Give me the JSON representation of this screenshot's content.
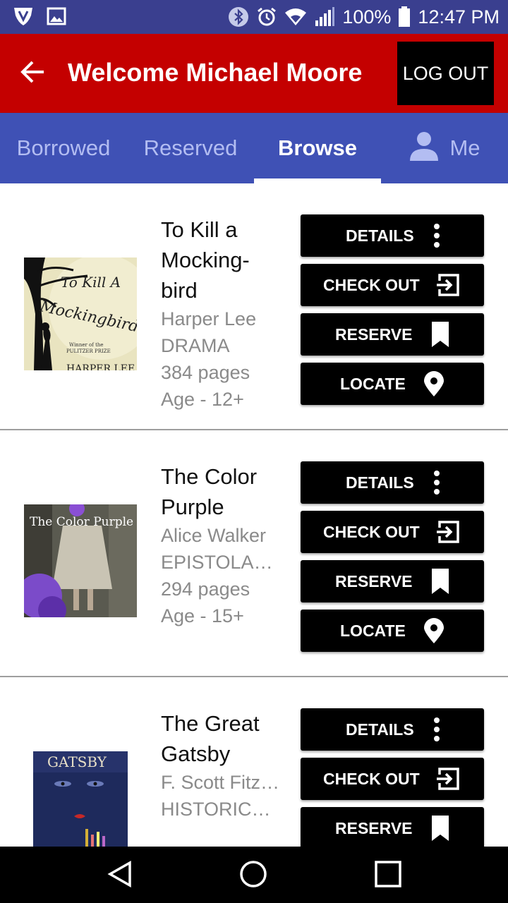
{
  "status_bar": {
    "battery": "100%",
    "time": "12:47 PM",
    "icons": [
      "shield-icon",
      "image-icon",
      "bluetooth-icon",
      "alarm-icon",
      "wifi-icon",
      "signal-icon",
      "battery-icon"
    ]
  },
  "app_bar": {
    "title": "Welcome Michael Moore",
    "logout_label": "LOG OUT",
    "background": "#c40000"
  },
  "tabs": [
    {
      "label": "Borrowed",
      "active": false
    },
    {
      "label": "Reserved",
      "active": false
    },
    {
      "label": "Browse",
      "active": true
    },
    {
      "label": "Me",
      "active": false,
      "icon": "person-icon"
    }
  ],
  "tab_bar_color": "#3f51b5",
  "button_labels": {
    "details": "DETAILS",
    "check_out": "CHECK OUT",
    "reserve": "RESERVE",
    "locate": "LOCATE"
  },
  "books": [
    {
      "title": "To Kill a Mocking-bird",
      "author": "Harper Lee",
      "genre": "DRAMA",
      "pages": "384 pages",
      "age": "Age - 12+"
    },
    {
      "title": "The Color Purple",
      "author": "Alice Walker",
      "genre": "EPISTOLAR…",
      "pages": "294 pages",
      "age": "Age - 15+"
    },
    {
      "title": "The Great Gatsby",
      "author": "F. Scott Fitz…",
      "genre": "HISTORICA…",
      "pages": "",
      "age": ""
    }
  ],
  "covers": {
    "mockingbird": {
      "title_line1": "To Kill A",
      "title_line2": "Mockingbird",
      "award_line1": "Winner of the",
      "award_line2": "PULITZER PRIZE",
      "author": "HARPER LEE"
    },
    "color_purple": {
      "title": "The Color Purple"
    },
    "gatsby": {
      "title": "GATSBY"
    }
  },
  "nav_bar": {
    "icons": [
      "back-triangle-icon",
      "home-circle-icon",
      "recents-square-icon"
    ]
  }
}
